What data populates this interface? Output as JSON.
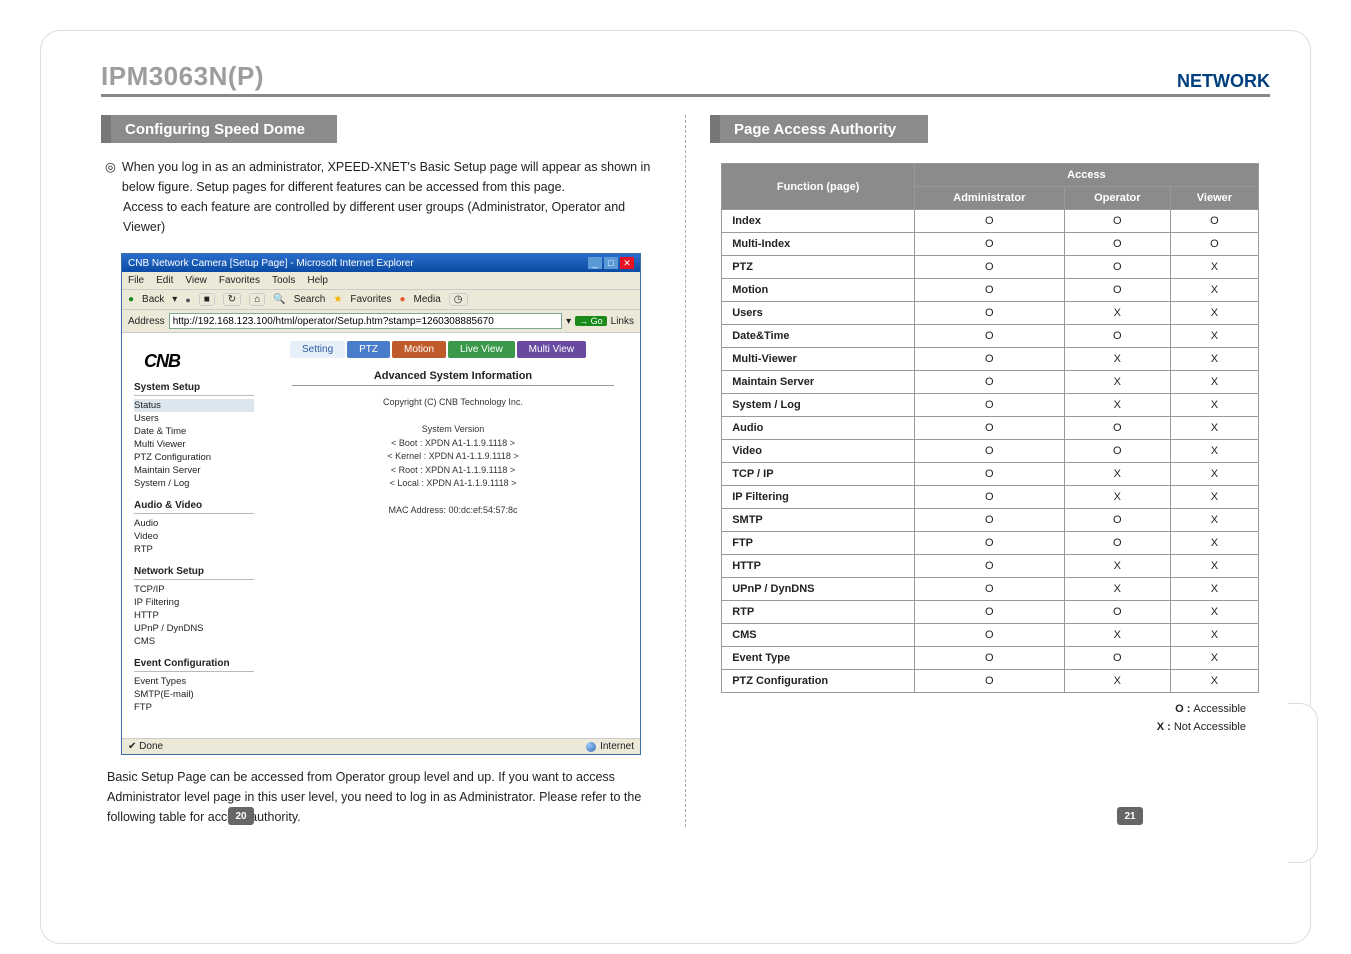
{
  "header": {
    "model": "IPM3063N(P)",
    "networkLabel": "NETWORK"
  },
  "left": {
    "sectionTitle": "Configuring Speed Dome",
    "bullet": "◎",
    "introLine1": "When you log in as an administrator, XPEED-XNET's Basic Setup page will appear as shown in below figure. Setup pages for different features can be accessed from this page.",
    "introLine2": "Access to each feature are controlled by different user groups (Administrator, Operator and Viewer)",
    "belowText": "Basic Setup Page can be accessed from Operator group level and up. If you want to access Administrator level page in this user level, you need to log in as Administrator. Please refer to the following table for access authority."
  },
  "ie": {
    "title": "CNB Network Camera [Setup Page] - Microsoft Internet Explorer",
    "menu": [
      "File",
      "Edit",
      "View",
      "Favorites",
      "Tools",
      "Help"
    ],
    "toolBack": "Back",
    "toolSearch": "Search",
    "toolFav": "Favorites",
    "toolMedia": "Media",
    "addrLabel": "Address",
    "addrValue": "http://192.168.123.100/html/operator/Setup.htm?stamp=1260308885670",
    "go": "Go",
    "links": "Links",
    "logo": "CNB",
    "tabs": [
      "Setting",
      "PTZ",
      "Motion",
      "Live View",
      "Multi View"
    ],
    "sideGroups": [
      {
        "h": "System Setup",
        "items": [
          "Status",
          "Users",
          "Date & Time",
          "Multi Viewer",
          "PTZ Configuration",
          "Maintain Server",
          "System / Log"
        ]
      },
      {
        "h": "Audio & Video",
        "items": [
          "Audio",
          "Video",
          "RTP"
        ]
      },
      {
        "h": "Network Setup",
        "items": [
          "TCP/IP",
          "IP Filtering",
          "HTTP",
          "UPnP / DynDNS",
          "CMS"
        ]
      },
      {
        "h": "Event Configuration",
        "items": [
          "Event Types",
          "SMTP(E-mail)",
          "FTP"
        ]
      }
    ],
    "infoHeader": "Advanced System Information",
    "copyright": "Copyright (C) CNB Technology Inc.",
    "sysVerLabel": "System Version",
    "sysVer": [
      "< Boot   : XPDN A1-1.1.9.1118 >",
      "< Kernel : XPDN A1-1.1.9.1118 >",
      "< Root   : XPDN A1-1.1.9.1118 >",
      "< Local  : XPDN A1-1.1.9.1118 >"
    ],
    "mac": "MAC Address: 00:dc:ef:54:57:8c",
    "statusDone": "Done",
    "statusZone": "Internet"
  },
  "right": {
    "sectionTitle": "Page Access Authority",
    "tableHeaders": {
      "fn": "Function (page)",
      "access": "Access",
      "admin": "Administrator",
      "op": "Operator",
      "vw": "Viewer"
    },
    "rows": [
      {
        "fn": "Index",
        "a": "O",
        "o": "O",
        "v": "O"
      },
      {
        "fn": "Multi-Index",
        "a": "O",
        "o": "O",
        "v": "O"
      },
      {
        "fn": "PTZ",
        "a": "O",
        "o": "O",
        "v": "X"
      },
      {
        "fn": "Motion",
        "a": "O",
        "o": "O",
        "v": "X"
      },
      {
        "fn": "Users",
        "a": "O",
        "o": "X",
        "v": "X"
      },
      {
        "fn": "Date&Time",
        "a": "O",
        "o": "O",
        "v": "X"
      },
      {
        "fn": "Multi-Viewer",
        "a": "O",
        "o": "X",
        "v": "X"
      },
      {
        "fn": "Maintain Server",
        "a": "O",
        "o": "X",
        "v": "X"
      },
      {
        "fn": "System / Log",
        "a": "O",
        "o": "X",
        "v": "X"
      },
      {
        "fn": "Audio",
        "a": "O",
        "o": "O",
        "v": "X"
      },
      {
        "fn": "Video",
        "a": "O",
        "o": "O",
        "v": "X"
      },
      {
        "fn": "TCP / IP",
        "a": "O",
        "o": "X",
        "v": "X"
      },
      {
        "fn": "IP Filtering",
        "a": "O",
        "o": "X",
        "v": "X"
      },
      {
        "fn": "SMTP",
        "a": "O",
        "o": "O",
        "v": "X"
      },
      {
        "fn": "FTP",
        "a": "O",
        "o": "O",
        "v": "X"
      },
      {
        "fn": "HTTP",
        "a": "O",
        "o": "X",
        "v": "X"
      },
      {
        "fn": "UPnP / DynDNS",
        "a": "O",
        "o": "X",
        "v": "X"
      },
      {
        "fn": "RTP",
        "a": "O",
        "o": "O",
        "v": "X"
      },
      {
        "fn": "CMS",
        "a": "O",
        "o": "X",
        "v": "X"
      },
      {
        "fn": "Event Type",
        "a": "O",
        "o": "O",
        "v": "X"
      },
      {
        "fn": "PTZ Configuration",
        "a": "O",
        "o": "X",
        "v": "X"
      }
    ],
    "legendO": "O : ",
    "legendOText": "Accessible",
    "legendX": "X : ",
    "legendXText": "Not Accessible"
  },
  "pages": {
    "left": "20",
    "right": "21"
  }
}
